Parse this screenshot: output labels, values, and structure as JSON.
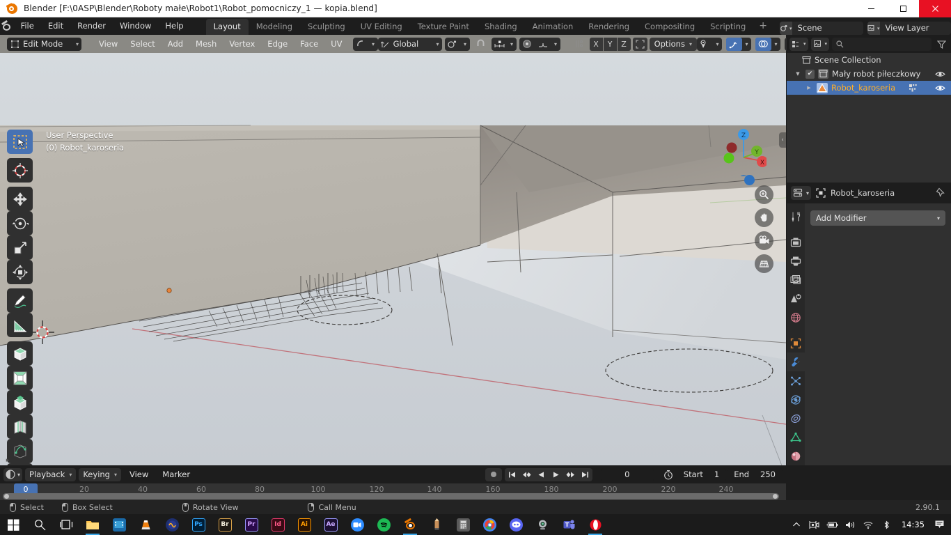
{
  "window": {
    "title": "Blender [F:\\0ASP\\Blender\\Roboty małe\\Robot1\\Robot_pomocniczy_1 — kopia.blend]",
    "app_icon": "blender-logo-icon",
    "minimize": "minimize-icon",
    "maximize": "maximize-icon",
    "close": "close-icon"
  },
  "topbar": {
    "menus": [
      "File",
      "Edit",
      "Render",
      "Window",
      "Help"
    ],
    "workspaces": [
      {
        "label": "Layout",
        "active": true
      },
      {
        "label": "Modeling",
        "active": false
      },
      {
        "label": "Sculpting",
        "active": false
      },
      {
        "label": "UV Editing",
        "active": false
      },
      {
        "label": "Texture Paint",
        "active": false
      },
      {
        "label": "Shading",
        "active": false
      },
      {
        "label": "Animation",
        "active": false
      },
      {
        "label": "Rendering",
        "active": false
      },
      {
        "label": "Compositing",
        "active": false
      },
      {
        "label": "Scripting",
        "active": false
      }
    ],
    "add_workspace": "+",
    "scene": {
      "label": "Scene",
      "copy": "new-scene-icon",
      "remove": "X"
    },
    "view_layer": {
      "label": "View Layer",
      "copy": "new-viewlayer-icon",
      "remove": "X"
    }
  },
  "viewport_header": {
    "mode": "Edit Mode",
    "mesh_select_modes": [
      "vertex-select-icon",
      "edge-select-icon",
      "face-select-icon"
    ],
    "active_select_mode_index": 2,
    "menus": [
      "View",
      "Select",
      "Add",
      "Mesh",
      "Vertex",
      "Edge",
      "Face",
      "UV"
    ],
    "orientation": "Global",
    "pivot": "pivot-point-icon",
    "snap": "snap-magnet-icon",
    "proportional_editing": "proportional-edit-icon",
    "proportional_falloff": "falloff-curve-icon",
    "mirror_axes": [
      "X",
      "Y",
      "Z"
    ],
    "options_label": "Options",
    "shading_modes": [
      "wireframe-shading-icon",
      "solid-shading-icon",
      "material-preview-icon",
      "rendered-shading-icon"
    ],
    "active_shading_index": 2
  },
  "viewport": {
    "overlay_line1": "User Perspective",
    "overlay_line2": "(0) Robot_karoseria",
    "gizmo_axes": {
      "z": "Z",
      "x": "X",
      "y": "Y"
    },
    "nav_buttons": [
      "zoom-icon",
      "pan-hand-icon",
      "camera-view-icon",
      "toggle-orthographic-icon"
    ],
    "toolbar_tools": [
      "tweak-select-box-icon",
      "cursor-icon",
      "move-icon",
      "rotate-icon",
      "scale-icon",
      "transform-icon",
      "annotate-icon",
      "measure-icon",
      "extrude-region-icon",
      "inset-faces-icon",
      "bevel-icon",
      "loop-cut-icon",
      "knife-icon",
      "poly-build-icon",
      "spin-icon",
      "smooth-icon"
    ],
    "bg_top_color": "#b7b3ab",
    "bg_bottom_color": "#cfd4d9",
    "red_axis_color": "#c05c5c"
  },
  "outliner": {
    "header": {
      "display_mode": "outliner-display-mode-icon",
      "filter_id": "filter-id-icon",
      "search_placeholder": "",
      "search_icon": "search-icon",
      "filter_icon": "filter-funnel-icon"
    },
    "rows": [
      {
        "label": "Scene Collection",
        "icon": "collection-icon",
        "indent": 0,
        "selected": false,
        "expandable": false,
        "checkbox": false,
        "eye": false
      },
      {
        "label": "Mały robot piłeczkowy",
        "icon": "collection-icon",
        "indent": 1,
        "selected": false,
        "expandable": true,
        "checkbox": true,
        "eye": true
      },
      {
        "label": "Robot_karoseria",
        "icon": "mesh-object-icon",
        "indent": 2,
        "selected": true,
        "expandable": true,
        "checkbox": false,
        "eye": true
      }
    ]
  },
  "properties": {
    "header": {
      "editor_type": "properties-editor-icon",
      "breadcrumb_icon": "object-icon",
      "breadcrumb": "Robot_karoseria",
      "pin": "pin-icon"
    },
    "tabs": [
      {
        "name": "tool-tab",
        "icon": "tool-screwdriver-wrench-icon",
        "active": false
      },
      {
        "name": "render-tab",
        "icon": "render-camera-back-icon",
        "active": false
      },
      {
        "name": "output-tab",
        "icon": "output-printer-icon",
        "active": false
      },
      {
        "name": "view-layer-tab",
        "icon": "view-layer-images-icon",
        "active": false
      },
      {
        "name": "scene-tab",
        "icon": "scene-cone-sphere-icon",
        "active": false
      },
      {
        "name": "world-tab",
        "icon": "world-globe-icon",
        "active": false
      },
      {
        "name": "object-tab",
        "icon": "object-square-icon",
        "active": false
      },
      {
        "name": "modifier-tab",
        "icon": "modifier-wrench-icon",
        "active": true
      },
      {
        "name": "particles-tab",
        "icon": "particles-icon",
        "active": false
      },
      {
        "name": "physics-tab",
        "icon": "physics-orbit-icon",
        "active": false
      },
      {
        "name": "constraints-tab",
        "icon": "object-constraints-icon",
        "active": false
      },
      {
        "name": "data-tab",
        "icon": "mesh-data-triangle-icon",
        "active": false
      },
      {
        "name": "material-tab",
        "icon": "material-sphere-icon",
        "active": false
      }
    ],
    "add_modifier_label": "Add Modifier"
  },
  "timeline": {
    "editor_type": "timeline-editor-icon",
    "menus": [
      {
        "label": "Playback",
        "dropdown": true
      },
      {
        "label": "Keying",
        "dropdown": true
      },
      {
        "label": "View",
        "dropdown": false
      },
      {
        "label": "Marker",
        "dropdown": false
      }
    ],
    "record_button": "auto-keying-record-icon",
    "transport": [
      "jump-to-start-icon",
      "jump-to-prev-keyframe-icon",
      "play-reverse-icon",
      "play-icon",
      "jump-to-next-keyframe-icon",
      "jump-to-end-icon"
    ],
    "current_frame": "0",
    "clock_icon": "frame-range-clock-icon",
    "start_label": "Start",
    "start_value": "1",
    "end_label": "End",
    "end_value": "250",
    "ruler_ticks": [
      "20",
      "40",
      "60",
      "80",
      "100",
      "120",
      "140",
      "160",
      "180",
      "200",
      "220",
      "240"
    ],
    "playhead_label": "0"
  },
  "statusbar": {
    "items": [
      {
        "icon": "mouse-left-icon",
        "label": "Select"
      },
      {
        "icon": "mouse-left-drag-icon",
        "label": "Box Select"
      },
      {
        "icon": "mouse-middle-icon",
        "label": "Rotate View"
      },
      {
        "icon": "mouse-right-icon",
        "label": "Call Menu"
      }
    ],
    "version": "2.90.1"
  },
  "taskbar": {
    "start": "windows-start-icon",
    "search": "search-icon",
    "task_view": "task-view-icon",
    "apps": [
      {
        "name": "file-explorer-icon",
        "color": "#ffb848",
        "label": ""
      },
      {
        "name": "movies-tv-icon",
        "color": "#1f6fa8",
        "label": ""
      },
      {
        "name": "vlc-icon",
        "color": "#e8760a",
        "label": ""
      },
      {
        "name": "audacity-icon",
        "color": "#2b3a8f",
        "label": ""
      },
      {
        "name": "photoshop-icon",
        "color": "#031d26",
        "label": "Ps"
      },
      {
        "name": "bridge-icon",
        "color": "#1c1714",
        "label": "Br"
      },
      {
        "name": "premiere-icon",
        "color": "#2a0a4a",
        "label": "Pr"
      },
      {
        "name": "indesign-icon",
        "color": "#380a13",
        "label": "Id"
      },
      {
        "name": "illustrator-icon",
        "color": "#2b1200",
        "label": "Ai"
      },
      {
        "name": "aftereffects-icon",
        "color": "#1c0f33",
        "label": "Ae"
      },
      {
        "name": "zoom-icon",
        "color": "#2d8cff",
        "label": ""
      },
      {
        "name": "spotify-icon",
        "color": "#1db954",
        "label": ""
      },
      {
        "name": "blender-icon",
        "color": "#ea7600",
        "label": ""
      },
      {
        "name": "pencil-app-icon",
        "color": "#b07040",
        "label": ""
      },
      {
        "name": "calculator-icon",
        "color": "#5a5a5a",
        "label": ""
      },
      {
        "name": "chrome-icon",
        "color": "#4285f4",
        "label": ""
      },
      {
        "name": "discord-icon",
        "color": "#5865f2",
        "label": ""
      },
      {
        "name": "webcam-icon",
        "color": "#9aa0a6",
        "label": ""
      },
      {
        "name": "teams-icon",
        "color": "#5059c9",
        "label": "T"
      },
      {
        "name": "opera-icon",
        "color": "#e81123",
        "label": ""
      }
    ],
    "tray": [
      "show-hidden-icons-icon",
      "camera-privacy-icon",
      "battery-icon",
      "volume-icon",
      "wifi-icon",
      "bluetooth-icon"
    ],
    "clock": "14:35",
    "notifications": "notifications-icon"
  }
}
